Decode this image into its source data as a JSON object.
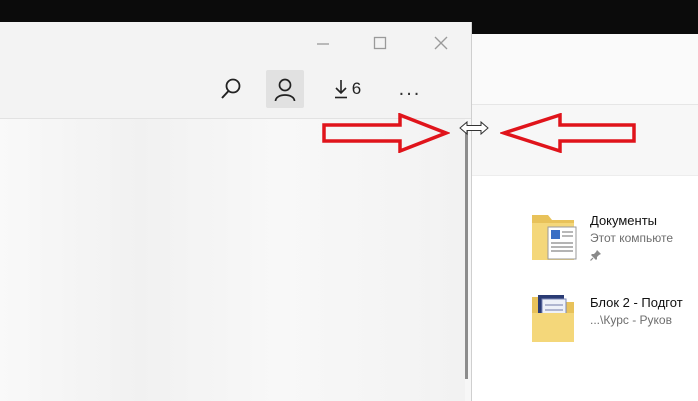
{
  "browser": {
    "window_controls": {
      "minimize_icon": "minimize-icon",
      "maximize_icon": "maximize-icon",
      "close_icon": "close-icon"
    },
    "toolbar": {
      "search_icon": "search-icon",
      "profile_icon": "profile-icon",
      "downloads_count": "6",
      "more_label": "..."
    }
  },
  "explorer": {
    "quick_access": [
      {
        "name": "Документы",
        "location": "Этот компьюте",
        "pinned": true
      },
      {
        "name": "Блок 2 - Подгот",
        "location": "...\\Курс - Руков",
        "pinned": false
      }
    ]
  },
  "annotation": {
    "arrow_color": "#e0141b",
    "cursor": "resize-horizontal-cursor"
  }
}
